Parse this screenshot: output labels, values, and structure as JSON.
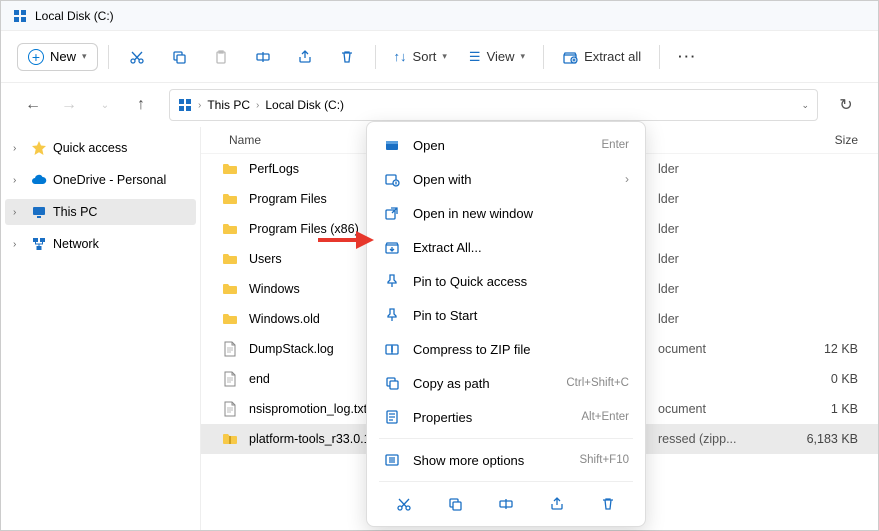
{
  "title": "Local Disk (C:)",
  "toolbar": {
    "new_label": "New",
    "sort_label": "Sort",
    "view_label": "View",
    "extract_label": "Extract all"
  },
  "breadcrumb": {
    "parts": [
      "This PC",
      "Local Disk (C:)"
    ]
  },
  "sidebar": {
    "items": [
      {
        "label": "Quick access",
        "icon": "star",
        "color": "#f7c948"
      },
      {
        "label": "OneDrive - Personal",
        "icon": "cloud",
        "color": "#0078d4"
      },
      {
        "label": "This PC",
        "icon": "monitor",
        "color": "#1a6fc4",
        "selected": true
      },
      {
        "label": "Network",
        "icon": "network",
        "color": "#1a6fc4"
      }
    ]
  },
  "columns": {
    "name": "Name",
    "type": "",
    "size": "Size"
  },
  "files": [
    {
      "name": "PerfLogs",
      "icon": "folder",
      "type": "lder",
      "size": ""
    },
    {
      "name": "Program Files",
      "icon": "folder",
      "type": "lder",
      "size": ""
    },
    {
      "name": "Program Files (x86)",
      "icon": "folder",
      "type": "lder",
      "size": ""
    },
    {
      "name": "Users",
      "icon": "folder",
      "type": "lder",
      "size": ""
    },
    {
      "name": "Windows",
      "icon": "folder",
      "type": "lder",
      "size": ""
    },
    {
      "name": "Windows.old",
      "icon": "folder",
      "type": "lder",
      "size": ""
    },
    {
      "name": "DumpStack.log",
      "icon": "file",
      "type": "ocument",
      "size": "12 KB"
    },
    {
      "name": "end",
      "icon": "file",
      "type": "",
      "size": "0 KB"
    },
    {
      "name": "nsispromotion_log.txt",
      "icon": "file",
      "type": "ocument",
      "size": "1 KB"
    },
    {
      "name": "platform-tools_r33.0.1-",
      "icon": "zip",
      "type": "ressed (zipp...",
      "size": "6,183 KB",
      "selected": true
    }
  ],
  "context_menu": {
    "items": [
      {
        "label": "Open",
        "icon": "open",
        "shortcut": "Enter"
      },
      {
        "label": "Open with",
        "icon": "openwith",
        "arrow": true
      },
      {
        "label": "Open in new window",
        "icon": "newwindow"
      },
      {
        "label": "Extract All...",
        "icon": "extract"
      },
      {
        "label": "Pin to Quick access",
        "icon": "pin"
      },
      {
        "label": "Pin to Start",
        "icon": "pin"
      },
      {
        "label": "Compress to ZIP file",
        "icon": "compress"
      },
      {
        "label": "Copy as path",
        "icon": "copypath",
        "shortcut": "Ctrl+Shift+C"
      },
      {
        "label": "Properties",
        "icon": "properties",
        "shortcut": "Alt+Enter"
      }
    ],
    "more": {
      "label": "Show more options",
      "shortcut": "Shift+F10"
    }
  }
}
